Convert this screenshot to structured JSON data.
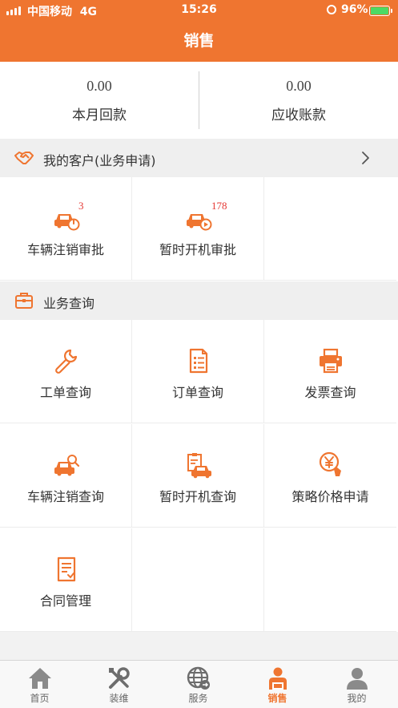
{
  "status_bar": {
    "carrier": "中国移动",
    "network": "4G",
    "time": "15:26",
    "battery": "96%"
  },
  "header": {
    "title": "销售"
  },
  "summary": [
    {
      "value": "0.00",
      "label": "本月回款"
    },
    {
      "value": "0.00",
      "label": "应收账款"
    }
  ],
  "customers": {
    "title": "我的客户(业务申请)",
    "items": [
      {
        "label": "车辆注销审批",
        "badge": "3",
        "icon": "car-power-icon"
      },
      {
        "label": "暂时开机审批",
        "badge": "178",
        "icon": "car-play-icon"
      }
    ]
  },
  "business": {
    "title": "业务查询",
    "items": [
      {
        "label": "工单查询",
        "icon": "wrench-icon"
      },
      {
        "label": "订单查询",
        "icon": "order-document-icon"
      },
      {
        "label": "发票查询",
        "icon": "printer-icon"
      },
      {
        "label": "车辆注销查询",
        "icon": "car-search-icon"
      },
      {
        "label": "暂时开机查询",
        "icon": "clipboard-car-icon"
      },
      {
        "label": "策略价格申请",
        "icon": "yen-tag-icon"
      },
      {
        "label": "合同管理",
        "icon": "contract-icon"
      }
    ]
  },
  "tabbar": {
    "active": "销售",
    "items": [
      {
        "label": "首页",
        "icon": "home-icon"
      },
      {
        "label": "装维",
        "icon": "tools-icon"
      },
      {
        "label": "服务",
        "icon": "globe-icon"
      },
      {
        "label": "销售",
        "icon": "salesperson-icon"
      },
      {
        "label": "我的",
        "icon": "user-icon"
      }
    ]
  },
  "colors": {
    "accent": "#ef7530",
    "badge": "#e53935",
    "background": "#f2f2f2"
  }
}
